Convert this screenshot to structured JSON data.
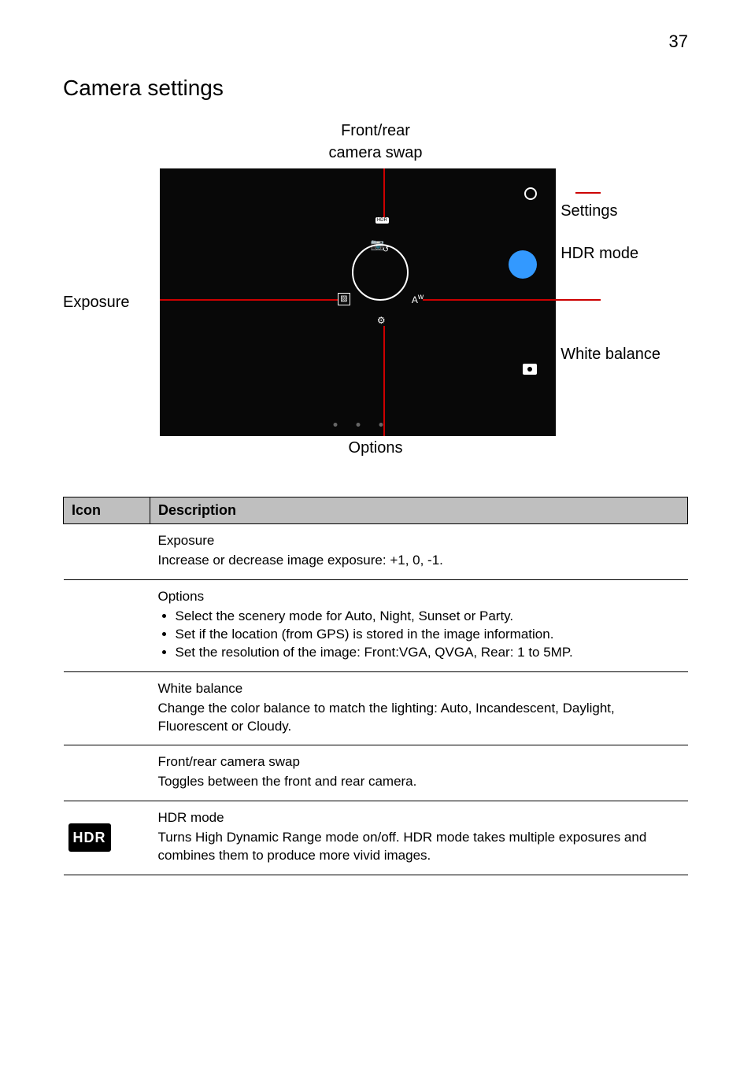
{
  "page_number": "37",
  "title": "Camera settings",
  "diagram": {
    "top_label_line1": "Front/rear",
    "top_label_line2": "camera swap",
    "left_label": "Exposure",
    "right_label_settings": "Settings",
    "right_label_hdr": "HDR mode",
    "right_label_wb": "White balance",
    "bottom_label": "Options",
    "hdr_badge": "HDR"
  },
  "table": {
    "header_icon": "Icon",
    "header_desc": "Description",
    "rows": [
      {
        "icon_key": "exposure",
        "title": "Exposure",
        "body": "Increase or decrease image exposure: +1, 0, -1."
      },
      {
        "icon_key": "options",
        "title": "Options",
        "bullets": [
          "Select the scenery mode for Auto, Night, Sunset or Party.",
          "Set if the location (from GPS) is stored in the image information.",
          "Set the resolution of the image: Front:VGA, QVGA, Rear: 1 to 5MP."
        ]
      },
      {
        "icon_key": "wb",
        "title": "White balance",
        "body": "Change the color balance to match the lighting: Auto, Incandescent, Daylight, Fluorescent or Cloudy."
      },
      {
        "icon_key": "swap",
        "title": "Front/rear camera swap",
        "body": "Toggles between the front and rear camera."
      },
      {
        "icon_key": "hdr",
        "hdr_text": "HDR",
        "title": "HDR mode",
        "body": "Turns High Dynamic Range mode on/off. HDR mode takes multiple exposures and combines them to produce more vivid images."
      }
    ]
  }
}
